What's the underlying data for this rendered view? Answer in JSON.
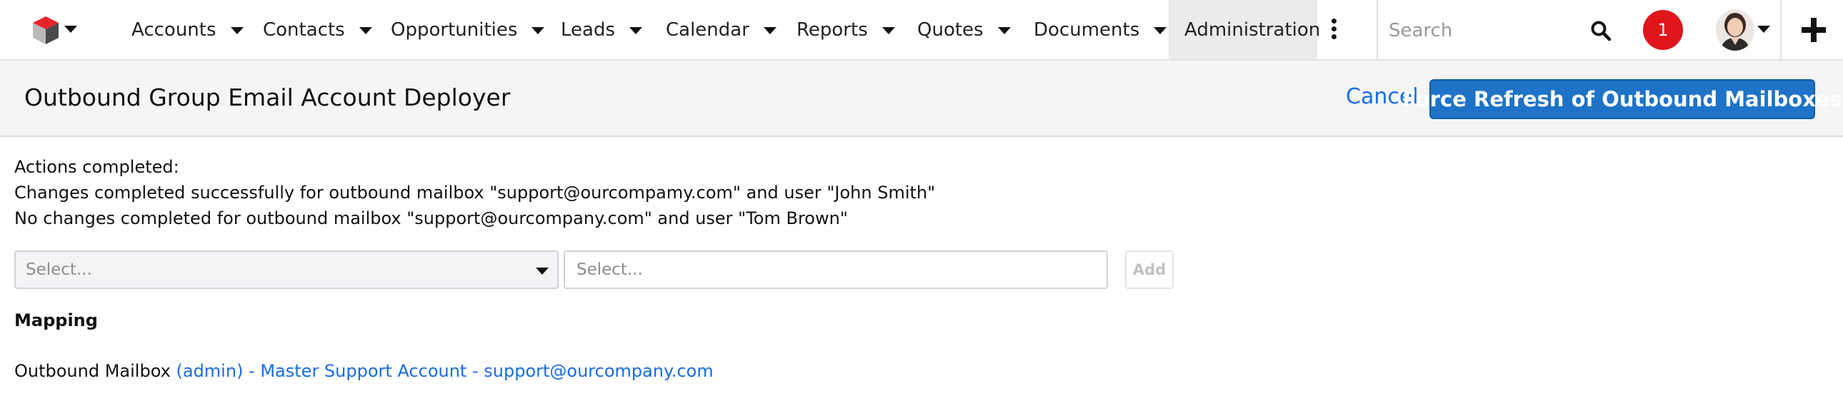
{
  "nav": {
    "items": [
      {
        "label": "Accounts"
      },
      {
        "label": "Contacts"
      },
      {
        "label": "Opportunities"
      },
      {
        "label": "Leads"
      },
      {
        "label": "Calendar"
      },
      {
        "label": "Reports"
      },
      {
        "label": "Quotes"
      },
      {
        "label": "Documents"
      }
    ],
    "active_item": "Administration",
    "search_placeholder": "Search",
    "notification_count": "1"
  },
  "header": {
    "title": "Outbound Group Email Account Deployer",
    "cancel_label": "Cancel",
    "primary_button_label": "Force Refresh of Outbound Mailboxes"
  },
  "content": {
    "actions_heading": "Actions completed:",
    "messages": [
      "Changes completed successfully for outbound mailbox \"support@ourcompamy.com\" and user \"John Smith\"",
      "No changes completed for outbound mailbox \"support@ourcompany.com\" and user \"Tom Brown\""
    ],
    "select_left_placeholder": "Select...",
    "select_right_placeholder": "Select...",
    "add_label": "Add",
    "mapping_heading": "Mapping",
    "mapping_label": "Outbound Mailbox",
    "mapping_link": "(admin) - Master Support Account - support@ourcompany.com"
  },
  "colors": {
    "accent": "#1e73c8",
    "link": "#176de5",
    "badge": "#e0161b"
  }
}
